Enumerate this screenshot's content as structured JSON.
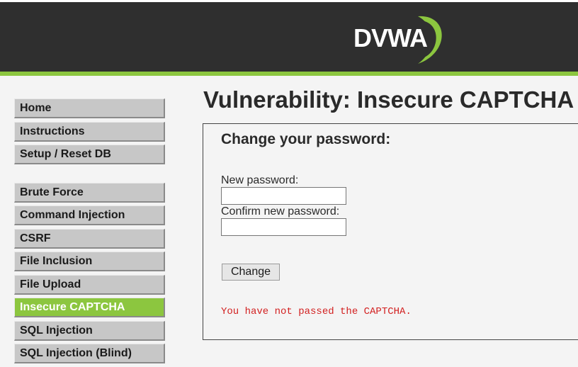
{
  "header": {
    "logo_text": "DVWA",
    "accent_color": "#8cc63f"
  },
  "sidebar": {
    "group1": [
      {
        "label": "Home"
      },
      {
        "label": "Instructions"
      },
      {
        "label": "Setup / Reset DB"
      }
    ],
    "group2": [
      {
        "label": "Brute Force"
      },
      {
        "label": "Command Injection"
      },
      {
        "label": "CSRF"
      },
      {
        "label": "File Inclusion"
      },
      {
        "label": "File Upload"
      },
      {
        "label": "Insecure CAPTCHA",
        "active": true
      },
      {
        "label": "SQL Injection"
      },
      {
        "label": "SQL Injection (Blind)"
      }
    ]
  },
  "main": {
    "title": "Vulnerability: Insecure CAPTCHA",
    "form": {
      "title": "Change your password:",
      "new_password_label": "New password:",
      "new_password_value": "",
      "confirm_password_label": "Confirm new password:",
      "confirm_password_value": "",
      "submit_label": "Change",
      "error_message": "You have not passed the CAPTCHA.",
      "error_color": "#d21f1f"
    }
  }
}
